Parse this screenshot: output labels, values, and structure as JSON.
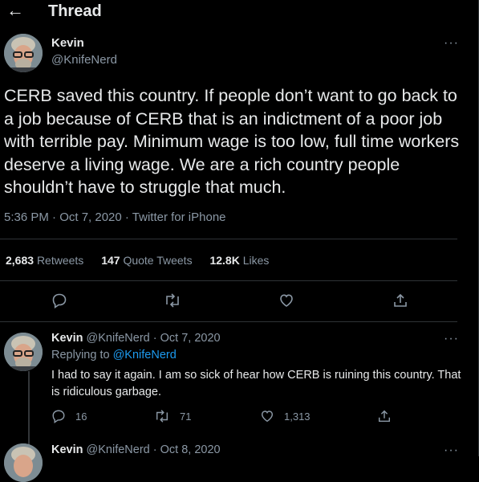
{
  "header": {
    "back_icon": "arrow-left-icon",
    "title": "Thread"
  },
  "main_tweet": {
    "name": "Kevin",
    "handle": "@KnifeNerd",
    "text": "CERB saved this country. If people don’t want to go back to a job because of CERB that is an indictment of a poor job with terrible pay. Minimum wage is too low, full time workers deserve a living wage. We are a rich country people shouldn’t have to struggle that much.",
    "meta": "5:36 PM · Oct 7, 2020 · Twitter for iPhone",
    "more": "···",
    "stats": {
      "retweets_count": "2,683",
      "retweets_label": "Retweets",
      "quotes_count": "147",
      "quotes_label": "Quote Tweets",
      "likes_count": "12.8K",
      "likes_label": "Likes"
    }
  },
  "replies": [
    {
      "name": "Kevin",
      "handle_date": "@KnifeNerd · Oct 7, 2020",
      "replying_prefix": "Replying to ",
      "replying_handle": "@KnifeNerd",
      "text": "I had to say it again. I am so sick of hear how CERB is ruining this country. That is ridiculous garbage.",
      "more": "···",
      "reply_count": "16",
      "retweet_count": "71",
      "like_count": "1,313"
    },
    {
      "name": "Kevin",
      "handle_date": "@KnifeNerd · Oct 8, 2020",
      "more": "···"
    }
  ],
  "colors": {
    "background": "#000000",
    "text": "#e7e9ea",
    "muted": "#8b98a5",
    "link": "#1d9bf0",
    "divider": "#2f3336"
  }
}
